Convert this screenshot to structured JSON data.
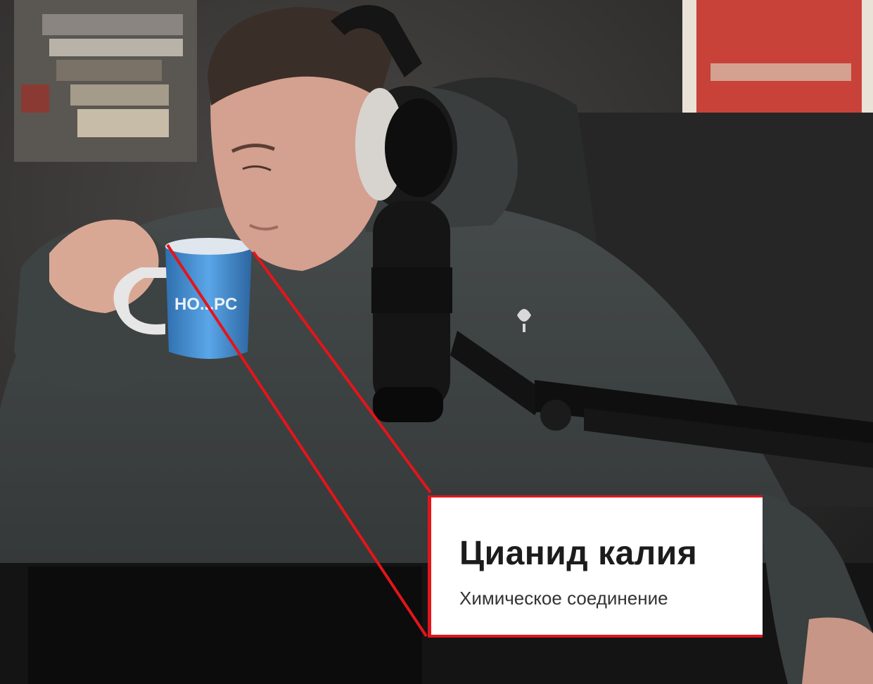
{
  "callout": {
    "title": "Цианид калия",
    "subtitle": "Химическое соединение"
  },
  "mug": {
    "print_text": "HO...PC"
  },
  "colors": {
    "accent_red": "#e3151a",
    "hoodie": "#3a3f3f",
    "mug_blue": "#4a8fd0"
  }
}
